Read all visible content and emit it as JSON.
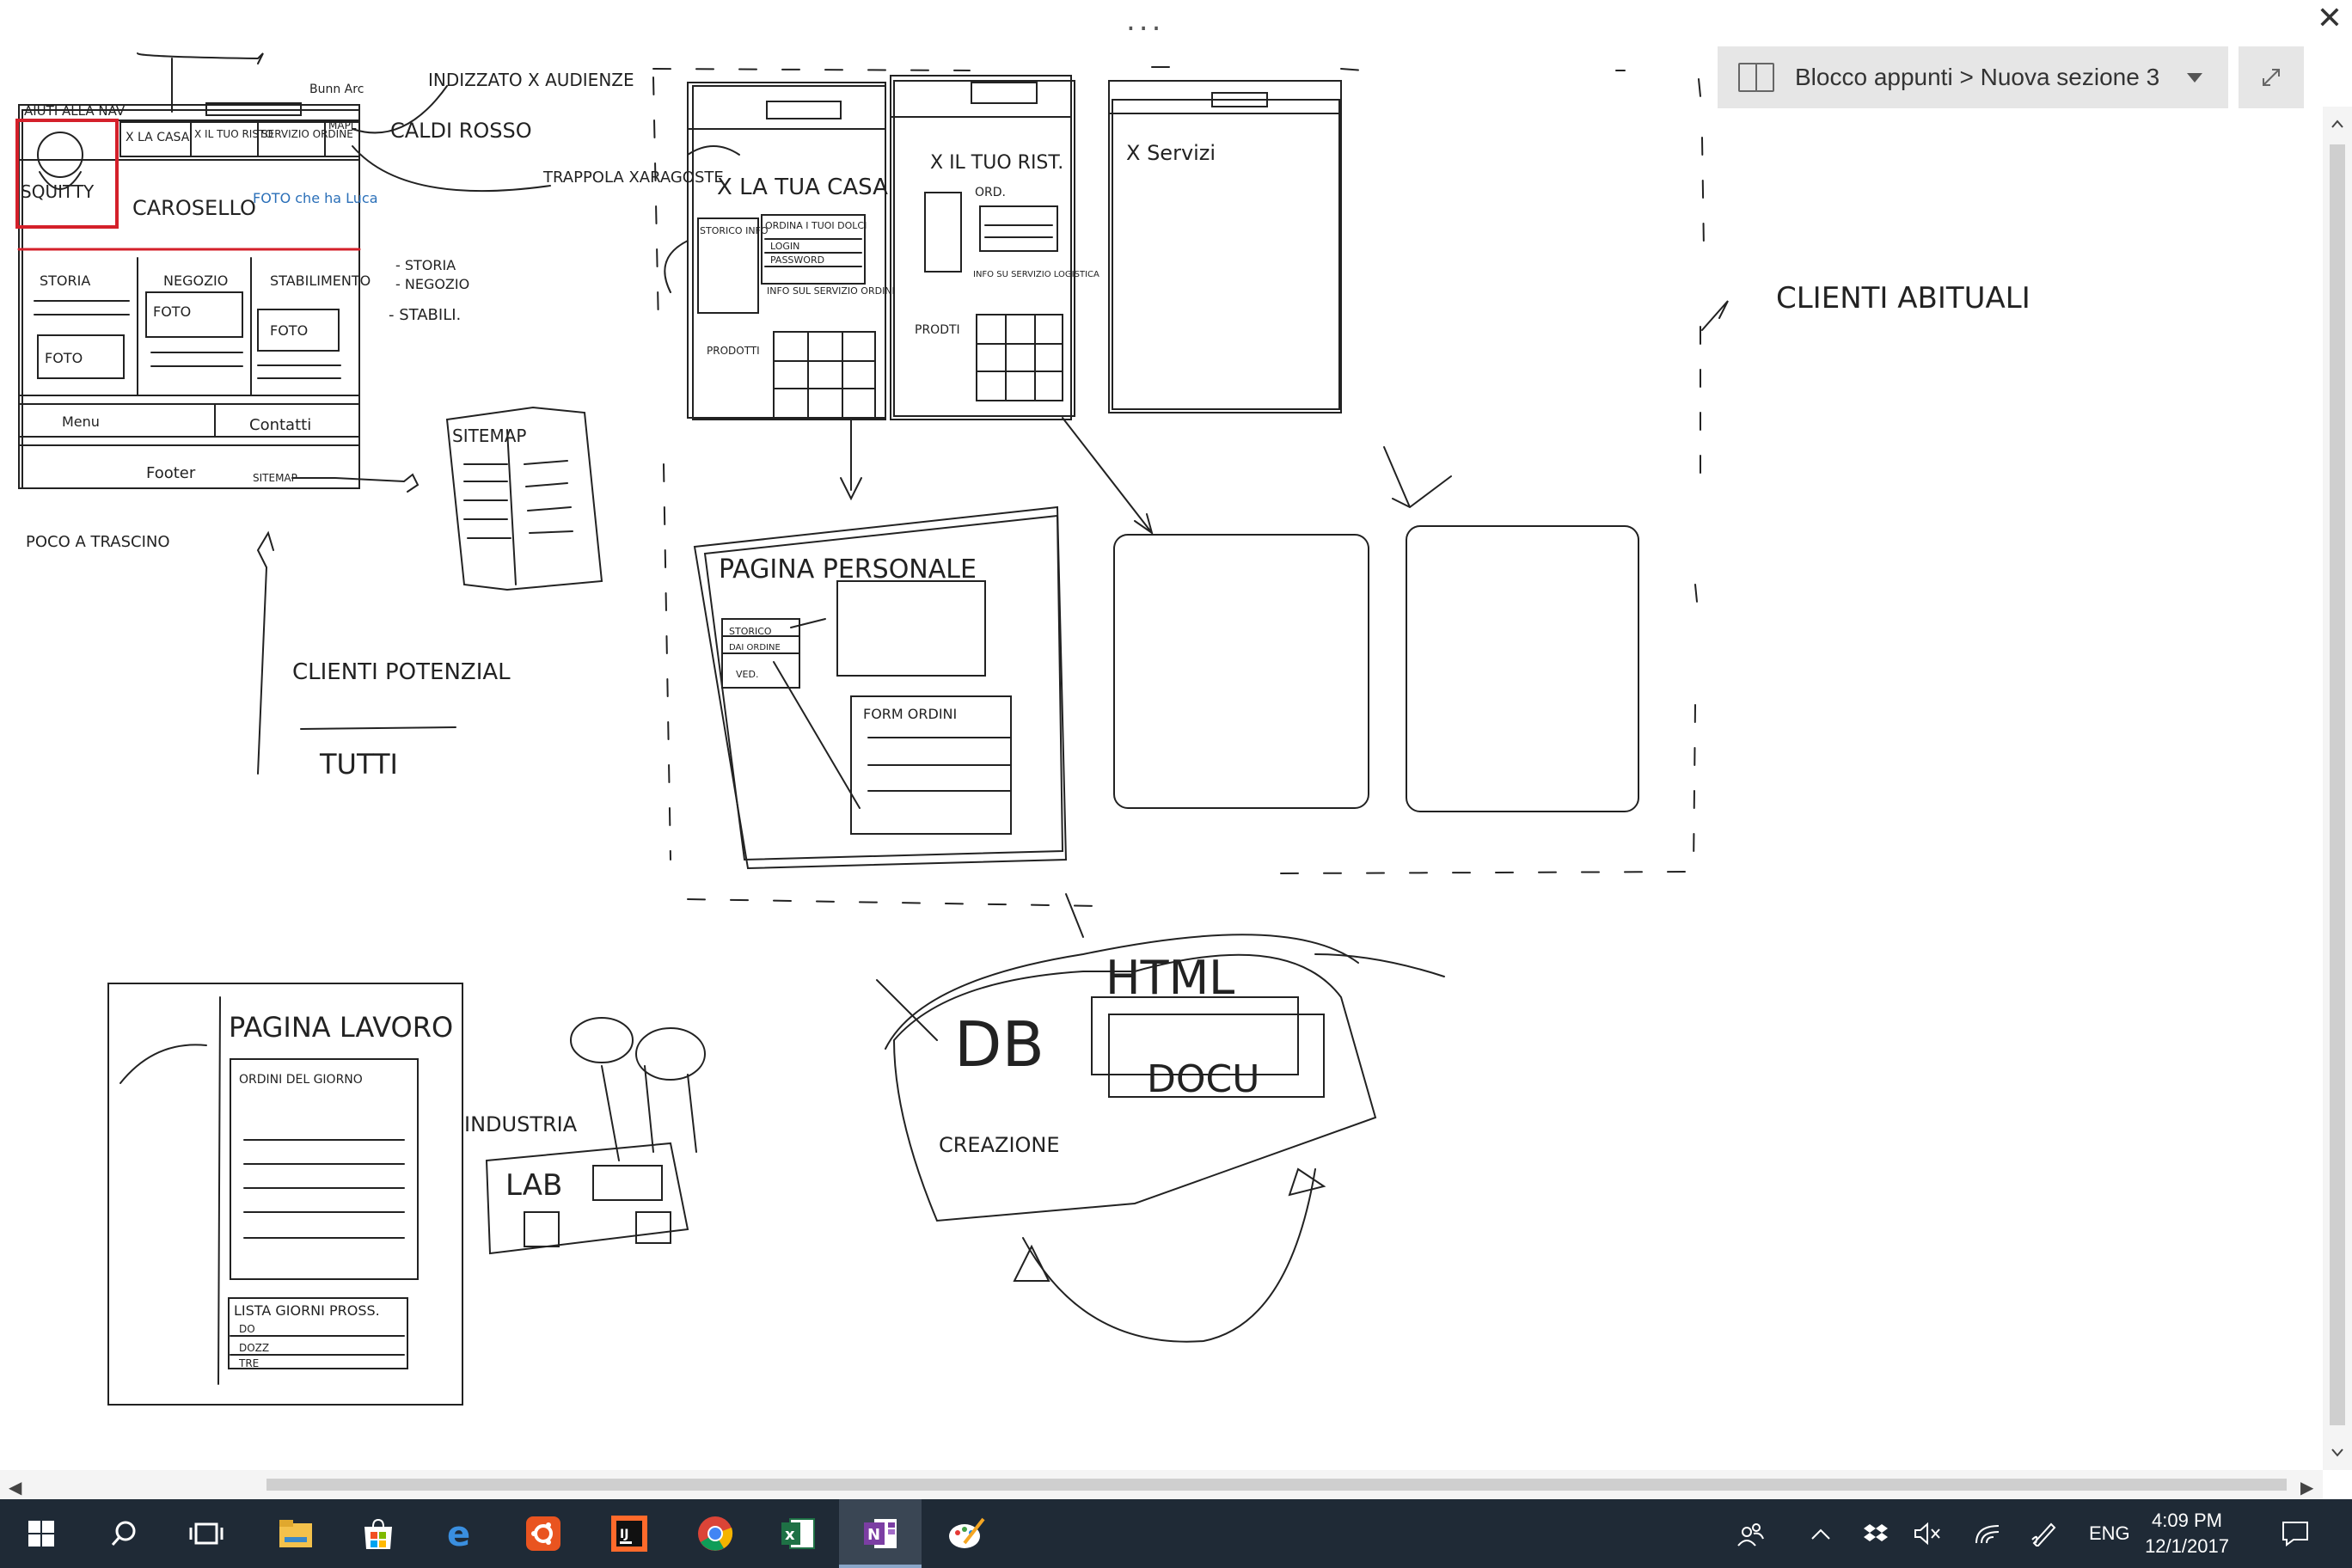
{
  "window": {
    "dots": "...",
    "close": "✕",
    "notebook_path": "Blocco appunti > Nuova sezione 3",
    "expand_icon": "expand-icon"
  },
  "sketch": {
    "top_left": {
      "nav_header": "AIUTI ALLA NAV",
      "icon_caption": "Bunn Arc",
      "logo_text": "SQUITTY",
      "tab1": "X LA CASA",
      "tab2": "X IL TUO RISTO",
      "tab3": "SERVIZIO ORDINE",
      "tab4": "MAPL",
      "carousel": "CAROSELLO",
      "carousel_note": "FOTO che ha Luca",
      "col1": "STORIA",
      "col2": "NEGOZIO",
      "col3": "STABILIMENTO",
      "foto": "FOTO",
      "menu": "Menu",
      "contacts": "Contatti",
      "footer": "Footer",
      "sitemap_small": "SITEMAP",
      "indexing_note": "INDIZZATO X AUDIENZE",
      "caldi_rosso": "CALDI ROSSO",
      "trappola": "TRAPPOLA XARAGOSTE",
      "bullet1": "- STORIA",
      "bullet2": "- NEGOZIO",
      "bullet3": "- STABILI.",
      "poco_trascino": "POCO A TRASCINO",
      "sitemap": "SITEMAP",
      "clienti_potenzial": "CLIENTI POTENZIAL",
      "tutti": "TUTTI"
    },
    "wireframes": {
      "casa_title": "X LA TUA CASA",
      "casa_box1": "STORICO INFO",
      "casa_box2": "ORDINA I TUOI DOLCI",
      "login": "LOGIN",
      "password": "PASSWORD",
      "info_servizio": "INFO SUL SERVIZIO ORDINI",
      "prodotti": "PRODOTTI",
      "rist_title": "X IL TUO RIST.",
      "ord": "ORD.",
      "info_servizio_rist": "INFO SU SERVIZIO LOGISTICA",
      "prodotti_rist": "PRODTI",
      "servizi_title": "X Servizi",
      "clienti_abituali": "CLIENTI ABITUALI",
      "pagina_personale": "PAGINA PERSONALE",
      "pp_storico": "STORICO",
      "pp_ordine": "DAI ORDINE",
      "pp_ved": "VED.",
      "form_ordini": "FORM ORDINI"
    },
    "bottom": {
      "pagina_lavoro": "PAGINA LAVORO",
      "ordini": "ORDINI DEL GIORNO",
      "lista": "LISTA GIORNI PROSS.",
      "l1": "DO",
      "l2": "DOZZ",
      "l3": "TRE",
      "industria": "INDUSTRIA",
      "lab": "LAB",
      "db": "DB",
      "html": "HTML",
      "docu": "DOCU",
      "creazione": "CREAZIONE"
    }
  },
  "taskbar": {
    "items": [
      {
        "name": "start-icon",
        "color": "#ffffff"
      },
      {
        "name": "search-icon",
        "color": "#ffffff"
      },
      {
        "name": "task-view-icon",
        "color": "#ffffff"
      },
      {
        "name": "file-explorer-icon",
        "color": "#f3c14b"
      },
      {
        "name": "store-icon",
        "color": "#ffffff"
      },
      {
        "name": "edge-icon",
        "color": "#3a8fe0"
      },
      {
        "name": "ubuntu-icon",
        "color": "#e95420"
      },
      {
        "name": "intellij-icon",
        "color": "#ffffff"
      },
      {
        "name": "chrome-icon",
        "color": "#4caf50"
      },
      {
        "name": "excel-icon",
        "color": "#1e7145"
      },
      {
        "name": "onenote-icon",
        "color": "#7b3ea3"
      },
      {
        "name": "paint-icon",
        "color": "#ffffff"
      }
    ],
    "lang": "ENG",
    "time": "4:09 PM",
    "date": "12/1/2017"
  }
}
